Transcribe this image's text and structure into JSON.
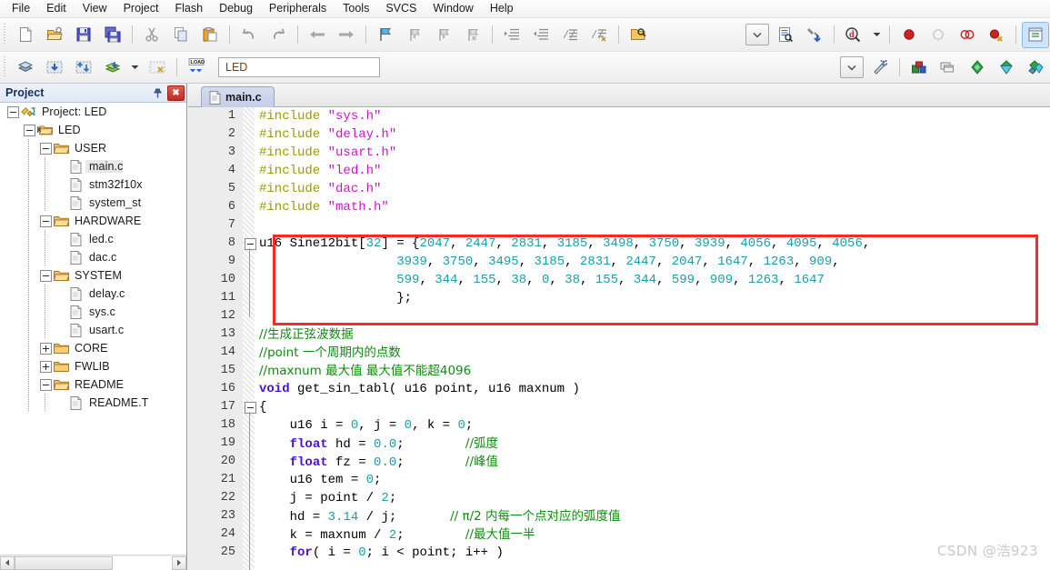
{
  "menubar": {
    "items": [
      {
        "label": "File"
      },
      {
        "label": "Edit"
      },
      {
        "label": "View"
      },
      {
        "label": "Project"
      },
      {
        "label": "Flash"
      },
      {
        "label": "Debug"
      },
      {
        "label": "Peripherals"
      },
      {
        "label": "Tools"
      },
      {
        "label": "SVCS"
      },
      {
        "label": "Window"
      },
      {
        "label": "Help"
      }
    ]
  },
  "toolbar_file": {
    "buttons": [
      {
        "name": "new-file-icon",
        "tip": "New"
      },
      {
        "name": "open-file-icon",
        "tip": "Open"
      },
      {
        "name": "save-icon",
        "tip": "Save"
      },
      {
        "name": "save-all-icon",
        "tip": "Save All"
      },
      {
        "name": "cut-icon",
        "tip": "Cut"
      },
      {
        "name": "copy-icon",
        "tip": "Copy"
      },
      {
        "name": "paste-icon",
        "tip": "Paste"
      },
      {
        "name": "undo-icon",
        "tip": "Undo"
      },
      {
        "name": "redo-icon",
        "tip": "Redo"
      },
      {
        "name": "navigate-back-icon",
        "tip": "Back"
      },
      {
        "name": "navigate-forward-icon",
        "tip": "Forward"
      },
      {
        "name": "bookmark-toggle-icon",
        "tip": "Insert/Remove Bookmark"
      },
      {
        "name": "bookmark-prev-icon",
        "tip": "Previous Bookmark"
      },
      {
        "name": "bookmark-next-icon",
        "tip": "Next Bookmark"
      },
      {
        "name": "bookmark-clear-icon",
        "tip": "Clear All Bookmarks"
      },
      {
        "name": "indent-icon",
        "tip": "Indent"
      },
      {
        "name": "outdent-icon",
        "tip": "Outdent"
      },
      {
        "name": "comment-icon",
        "tip": "Comment"
      },
      {
        "name": "uncomment-icon",
        "tip": "Uncomment"
      },
      {
        "name": "find-in-files-icon",
        "tip": "Find in Files"
      },
      {
        "name": "options-dropdown-icon",
        "tip": "Options"
      },
      {
        "name": "configuration-wizard-icon",
        "tip": "Configuration Wizard"
      },
      {
        "name": "debug-settings-icon",
        "tip": "Debug Settings"
      },
      {
        "name": "search-target-icon",
        "tip": "Find"
      },
      {
        "name": "breakpoint-insert-icon",
        "tip": "Insert/Remove Breakpoint"
      },
      {
        "name": "breakpoint-disable-icon",
        "tip": "Enable/Disable Breakpoint"
      },
      {
        "name": "breakpoint-disable-all-icon",
        "tip": "Disable All Breakpoints"
      },
      {
        "name": "breakpoint-kill-all-icon",
        "tip": "Kill All Breakpoints"
      },
      {
        "name": "project-window-icon",
        "tip": "Project Window"
      }
    ]
  },
  "toolbar_build": {
    "target_value": "LED",
    "buttons": [
      {
        "name": "translate-icon",
        "tip": "Translate"
      },
      {
        "name": "build-icon",
        "tip": "Build"
      },
      {
        "name": "rebuild-icon",
        "tip": "Rebuild"
      },
      {
        "name": "batch-build-icon",
        "tip": "Batch Build"
      },
      {
        "name": "stop-build-icon",
        "tip": "Stop Build"
      },
      {
        "name": "download-icon",
        "tip": "Download"
      },
      {
        "name": "target-options-icon",
        "tip": "Options for Target"
      },
      {
        "name": "manage-components-icon",
        "tip": "Manage Project Items"
      },
      {
        "name": "multi-project-icon",
        "tip": "Manage Multi-Project"
      },
      {
        "name": "pack-installer-icon",
        "tip": "Pack Installer"
      },
      {
        "name": "manage-run-time-icon",
        "tip": "Manage Run-Time Environment"
      },
      {
        "name": "select-software-packs-icon",
        "tip": "Select Software Packs"
      }
    ]
  },
  "project_panel": {
    "title": "Project",
    "pin_icon": "pin-icon",
    "close_label": "✖",
    "tree": [
      {
        "label": "Project: LED",
        "depth": 0,
        "icon": "project-icon",
        "expander": "minus"
      },
      {
        "label": "LED",
        "depth": 1,
        "icon": "target-icon",
        "expander": "minus"
      },
      {
        "label": "USER",
        "depth": 2,
        "icon": "folder-open-icon",
        "expander": "minus"
      },
      {
        "label": "main.c",
        "depth": 3,
        "icon": "file-icon",
        "expander": "none",
        "selected": true
      },
      {
        "label": "stm32f10x",
        "depth": 3,
        "icon": "file-icon",
        "expander": "none"
      },
      {
        "label": "system_st",
        "depth": 3,
        "icon": "file-icon",
        "expander": "none"
      },
      {
        "label": "HARDWARE",
        "depth": 2,
        "icon": "folder-open-icon",
        "expander": "minus"
      },
      {
        "label": "led.c",
        "depth": 3,
        "icon": "file-icon",
        "expander": "none"
      },
      {
        "label": "dac.c",
        "depth": 3,
        "icon": "file-icon",
        "expander": "none"
      },
      {
        "label": "SYSTEM",
        "depth": 2,
        "icon": "folder-open-icon",
        "expander": "minus"
      },
      {
        "label": "delay.c",
        "depth": 3,
        "icon": "file-icon",
        "expander": "none"
      },
      {
        "label": "sys.c",
        "depth": 3,
        "icon": "file-icon",
        "expander": "none"
      },
      {
        "label": "usart.c",
        "depth": 3,
        "icon": "file-icon",
        "expander": "none"
      },
      {
        "label": "CORE",
        "depth": 2,
        "icon": "folder-closed-icon",
        "expander": "plus"
      },
      {
        "label": "FWLIB",
        "depth": 2,
        "icon": "folder-closed-icon",
        "expander": "plus"
      },
      {
        "label": "README",
        "depth": 2,
        "icon": "folder-open-icon",
        "expander": "minus"
      },
      {
        "label": "README.T",
        "depth": 3,
        "icon": "file-icon",
        "expander": "none"
      }
    ]
  },
  "editor": {
    "tab_label": "main.c",
    "lines": [
      {
        "n": "1",
        "fold": false,
        "tokens": [
          {
            "t": "#include ",
            "c": "pp"
          },
          {
            "t": "\"sys.h\"",
            "c": "str"
          }
        ]
      },
      {
        "n": "2",
        "fold": false,
        "tokens": [
          {
            "t": "#include ",
            "c": "pp"
          },
          {
            "t": "\"delay.h\"",
            "c": "str"
          }
        ]
      },
      {
        "n": "3",
        "fold": false,
        "tokens": [
          {
            "t": "#include ",
            "c": "pp"
          },
          {
            "t": "\"usart.h\"",
            "c": "str"
          }
        ]
      },
      {
        "n": "4",
        "fold": false,
        "tokens": [
          {
            "t": "#include ",
            "c": "pp"
          },
          {
            "t": "\"led.h\"",
            "c": "str"
          }
        ]
      },
      {
        "n": "5",
        "fold": false,
        "tokens": [
          {
            "t": "#include ",
            "c": "pp"
          },
          {
            "t": "\"dac.h\"",
            "c": "str"
          }
        ]
      },
      {
        "n": "6",
        "fold": false,
        "tokens": [
          {
            "t": "#include ",
            "c": "pp"
          },
          {
            "t": "\"math.h\"",
            "c": "str"
          }
        ]
      },
      {
        "n": "7",
        "fold": false,
        "tokens": []
      },
      {
        "n": "8",
        "fold": true,
        "tokens": [
          {
            "t": "u16 Sine12bit[",
            "c": "plain"
          },
          {
            "t": "32",
            "c": "num-lit"
          },
          {
            "t": "] = {",
            "c": "plain"
          },
          {
            "t": "2047",
            "c": "num-lit"
          },
          {
            "t": ", ",
            "c": "plain"
          },
          {
            "t": "2447",
            "c": "num-lit"
          },
          {
            "t": ", ",
            "c": "plain"
          },
          {
            "t": "2831",
            "c": "num-lit"
          },
          {
            "t": ", ",
            "c": "plain"
          },
          {
            "t": "3185",
            "c": "num-lit"
          },
          {
            "t": ", ",
            "c": "plain"
          },
          {
            "t": "3498",
            "c": "num-lit"
          },
          {
            "t": ", ",
            "c": "plain"
          },
          {
            "t": "3750",
            "c": "num-lit"
          },
          {
            "t": ", ",
            "c": "plain"
          },
          {
            "t": "3939",
            "c": "num-lit"
          },
          {
            "t": ", ",
            "c": "plain"
          },
          {
            "t": "4056",
            "c": "num-lit"
          },
          {
            "t": ", ",
            "c": "plain"
          },
          {
            "t": "4095",
            "c": "num-lit"
          },
          {
            "t": ", ",
            "c": "plain"
          },
          {
            "t": "4056",
            "c": "num-lit"
          },
          {
            "t": ",",
            "c": "plain"
          }
        ]
      },
      {
        "n": "9",
        "fold": false,
        "tokens": [
          {
            "t": "                  ",
            "c": "plain"
          },
          {
            "t": "3939",
            "c": "num-lit"
          },
          {
            "t": ", ",
            "c": "plain"
          },
          {
            "t": "3750",
            "c": "num-lit"
          },
          {
            "t": ", ",
            "c": "plain"
          },
          {
            "t": "3495",
            "c": "num-lit"
          },
          {
            "t": ", ",
            "c": "plain"
          },
          {
            "t": "3185",
            "c": "num-lit"
          },
          {
            "t": ", ",
            "c": "plain"
          },
          {
            "t": "2831",
            "c": "num-lit"
          },
          {
            "t": ", ",
            "c": "plain"
          },
          {
            "t": "2447",
            "c": "num-lit"
          },
          {
            "t": ", ",
            "c": "plain"
          },
          {
            "t": "2047",
            "c": "num-lit"
          },
          {
            "t": ", ",
            "c": "plain"
          },
          {
            "t": "1647",
            "c": "num-lit"
          },
          {
            "t": ", ",
            "c": "plain"
          },
          {
            "t": "1263",
            "c": "num-lit"
          },
          {
            "t": ", ",
            "c": "plain"
          },
          {
            "t": "909",
            "c": "num-lit"
          },
          {
            "t": ",",
            "c": "plain"
          }
        ]
      },
      {
        "n": "10",
        "fold": false,
        "tokens": [
          {
            "t": "                  ",
            "c": "plain"
          },
          {
            "t": "599",
            "c": "num-lit"
          },
          {
            "t": ", ",
            "c": "plain"
          },
          {
            "t": "344",
            "c": "num-lit"
          },
          {
            "t": ", ",
            "c": "plain"
          },
          {
            "t": "155",
            "c": "num-lit"
          },
          {
            "t": ", ",
            "c": "plain"
          },
          {
            "t": "38",
            "c": "num-lit"
          },
          {
            "t": ", ",
            "c": "plain"
          },
          {
            "t": "0",
            "c": "num-lit"
          },
          {
            "t": ", ",
            "c": "plain"
          },
          {
            "t": "38",
            "c": "num-lit"
          },
          {
            "t": ", ",
            "c": "plain"
          },
          {
            "t": "155",
            "c": "num-lit"
          },
          {
            "t": ", ",
            "c": "plain"
          },
          {
            "t": "344",
            "c": "num-lit"
          },
          {
            "t": ", ",
            "c": "plain"
          },
          {
            "t": "599",
            "c": "num-lit"
          },
          {
            "t": ", ",
            "c": "plain"
          },
          {
            "t": "909",
            "c": "num-lit"
          },
          {
            "t": ", ",
            "c": "plain"
          },
          {
            "t": "1263",
            "c": "num-lit"
          },
          {
            "t": ", ",
            "c": "plain"
          },
          {
            "t": "1647",
            "c": "num-lit"
          }
        ]
      },
      {
        "n": "11",
        "fold": false,
        "tokens": [
          {
            "t": "                  };",
            "c": "plain"
          }
        ]
      },
      {
        "n": "12",
        "fold": false,
        "tokens": []
      },
      {
        "n": "13",
        "fold": false,
        "tokens": [
          {
            "t": "//生成正弦波数据",
            "c": "cmt-cn"
          }
        ]
      },
      {
        "n": "14",
        "fold": false,
        "tokens": [
          {
            "t": "//point 一个周期内的点数",
            "c": "cmt-cn"
          }
        ]
      },
      {
        "n": "15",
        "fold": false,
        "tokens": [
          {
            "t": "//maxnum 最大值 最大值不能超4096",
            "c": "cmt-cn"
          }
        ]
      },
      {
        "n": "16",
        "fold": false,
        "tokens": [
          {
            "t": "void",
            "c": "kw"
          },
          {
            "t": " get_sin_tabl( u16 point, u16 maxnum )",
            "c": "plain"
          }
        ]
      },
      {
        "n": "17",
        "fold": true,
        "tokens": [
          {
            "t": "{",
            "c": "plain"
          }
        ]
      },
      {
        "n": "18",
        "fold": false,
        "tokens": [
          {
            "t": "    u16 i = ",
            "c": "plain"
          },
          {
            "t": "0",
            "c": "num-lit"
          },
          {
            "t": ", j = ",
            "c": "plain"
          },
          {
            "t": "0",
            "c": "num-lit"
          },
          {
            "t": ", k = ",
            "c": "plain"
          },
          {
            "t": "0",
            "c": "num-lit"
          },
          {
            "t": ";",
            "c": "plain"
          }
        ]
      },
      {
        "n": "19",
        "fold": false,
        "tokens": [
          {
            "t": "    ",
            "c": "plain"
          },
          {
            "t": "float",
            "c": "kw"
          },
          {
            "t": " hd = ",
            "c": "plain"
          },
          {
            "t": "0.0",
            "c": "num-lit"
          },
          {
            "t": ";        ",
            "c": "plain"
          },
          {
            "t": "//弧度",
            "c": "cmt-cn"
          }
        ]
      },
      {
        "n": "20",
        "fold": false,
        "tokens": [
          {
            "t": "    ",
            "c": "plain"
          },
          {
            "t": "float",
            "c": "kw"
          },
          {
            "t": " fz = ",
            "c": "plain"
          },
          {
            "t": "0.0",
            "c": "num-lit"
          },
          {
            "t": ";        ",
            "c": "plain"
          },
          {
            "t": "//峰值",
            "c": "cmt-cn"
          }
        ]
      },
      {
        "n": "21",
        "fold": false,
        "tokens": [
          {
            "t": "    u16 tem = ",
            "c": "plain"
          },
          {
            "t": "0",
            "c": "num-lit"
          },
          {
            "t": ";",
            "c": "plain"
          }
        ]
      },
      {
        "n": "22",
        "fold": false,
        "tokens": [
          {
            "t": "    j = point / ",
            "c": "plain"
          },
          {
            "t": "2",
            "c": "num-lit"
          },
          {
            "t": ";",
            "c": "plain"
          }
        ]
      },
      {
        "n": "23",
        "fold": false,
        "tokens": [
          {
            "t": "    hd = ",
            "c": "plain"
          },
          {
            "t": "3.14",
            "c": "num-lit"
          },
          {
            "t": " / j;       ",
            "c": "plain"
          },
          {
            "t": "// π/2 内每一个点对应的弧度值",
            "c": "cmt-cn"
          }
        ]
      },
      {
        "n": "24",
        "fold": false,
        "tokens": [
          {
            "t": "    k = maxnum / ",
            "c": "plain"
          },
          {
            "t": "2",
            "c": "num-lit"
          },
          {
            "t": ";        ",
            "c": "plain"
          },
          {
            "t": "//最大值一半",
            "c": "cmt-cn"
          }
        ]
      },
      {
        "n": "25",
        "fold": false,
        "tokens": [
          {
            "t": "    ",
            "c": "plain"
          },
          {
            "t": "for",
            "c": "kw"
          },
          {
            "t": "( i = ",
            "c": "plain"
          },
          {
            "t": "0",
            "c": "num-lit"
          },
          {
            "t": "; i < point; i++ )",
            "c": "plain"
          }
        ]
      }
    ]
  },
  "annotation": {
    "highlight_color": "#fb2a22"
  },
  "watermark": {
    "text": "CSDN @浩923"
  }
}
